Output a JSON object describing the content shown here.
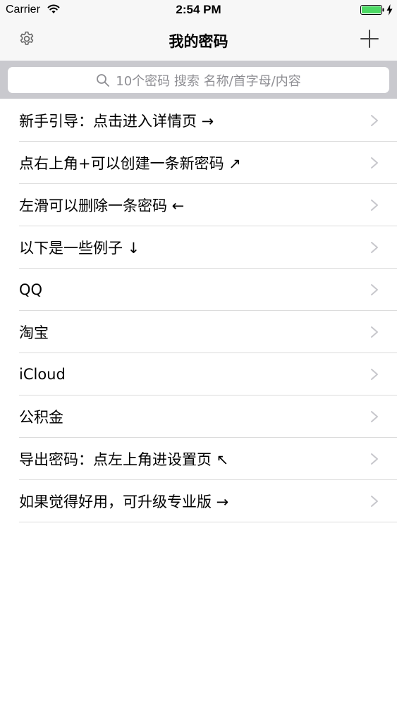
{
  "status_bar": {
    "carrier": "Carrier",
    "time": "2:54 PM",
    "wifi_icon": "wifi-icon",
    "battery_icon": "battery-full-icon",
    "charge_icon": "charging-bolt-icon",
    "battery_color": "#4cd964"
  },
  "nav_bar": {
    "title": "我的密码",
    "left_icon": "gear-icon",
    "right_icon": "plus-icon"
  },
  "search": {
    "placeholder": "10个密码 搜索 名称/首字母/内容",
    "icon": "search-icon"
  },
  "list": {
    "items": [
      {
        "label": "新手引导：点击进入详情页 →"
      },
      {
        "label": "点右上角+可以创建一条新密码 ↗"
      },
      {
        "label": "左滑可以删除一条密码 ←"
      },
      {
        "label": "以下是一些例子 ↓"
      },
      {
        "label": "QQ"
      },
      {
        "label": "淘宝"
      },
      {
        "label": "iCloud"
      },
      {
        "label": "公积金"
      },
      {
        "label": "导出密码：点左上角进设置页 ↖"
      },
      {
        "label": "如果觉得好用，可升级专业版 →"
      }
    ],
    "chevron_icon": "chevron-right-icon"
  }
}
